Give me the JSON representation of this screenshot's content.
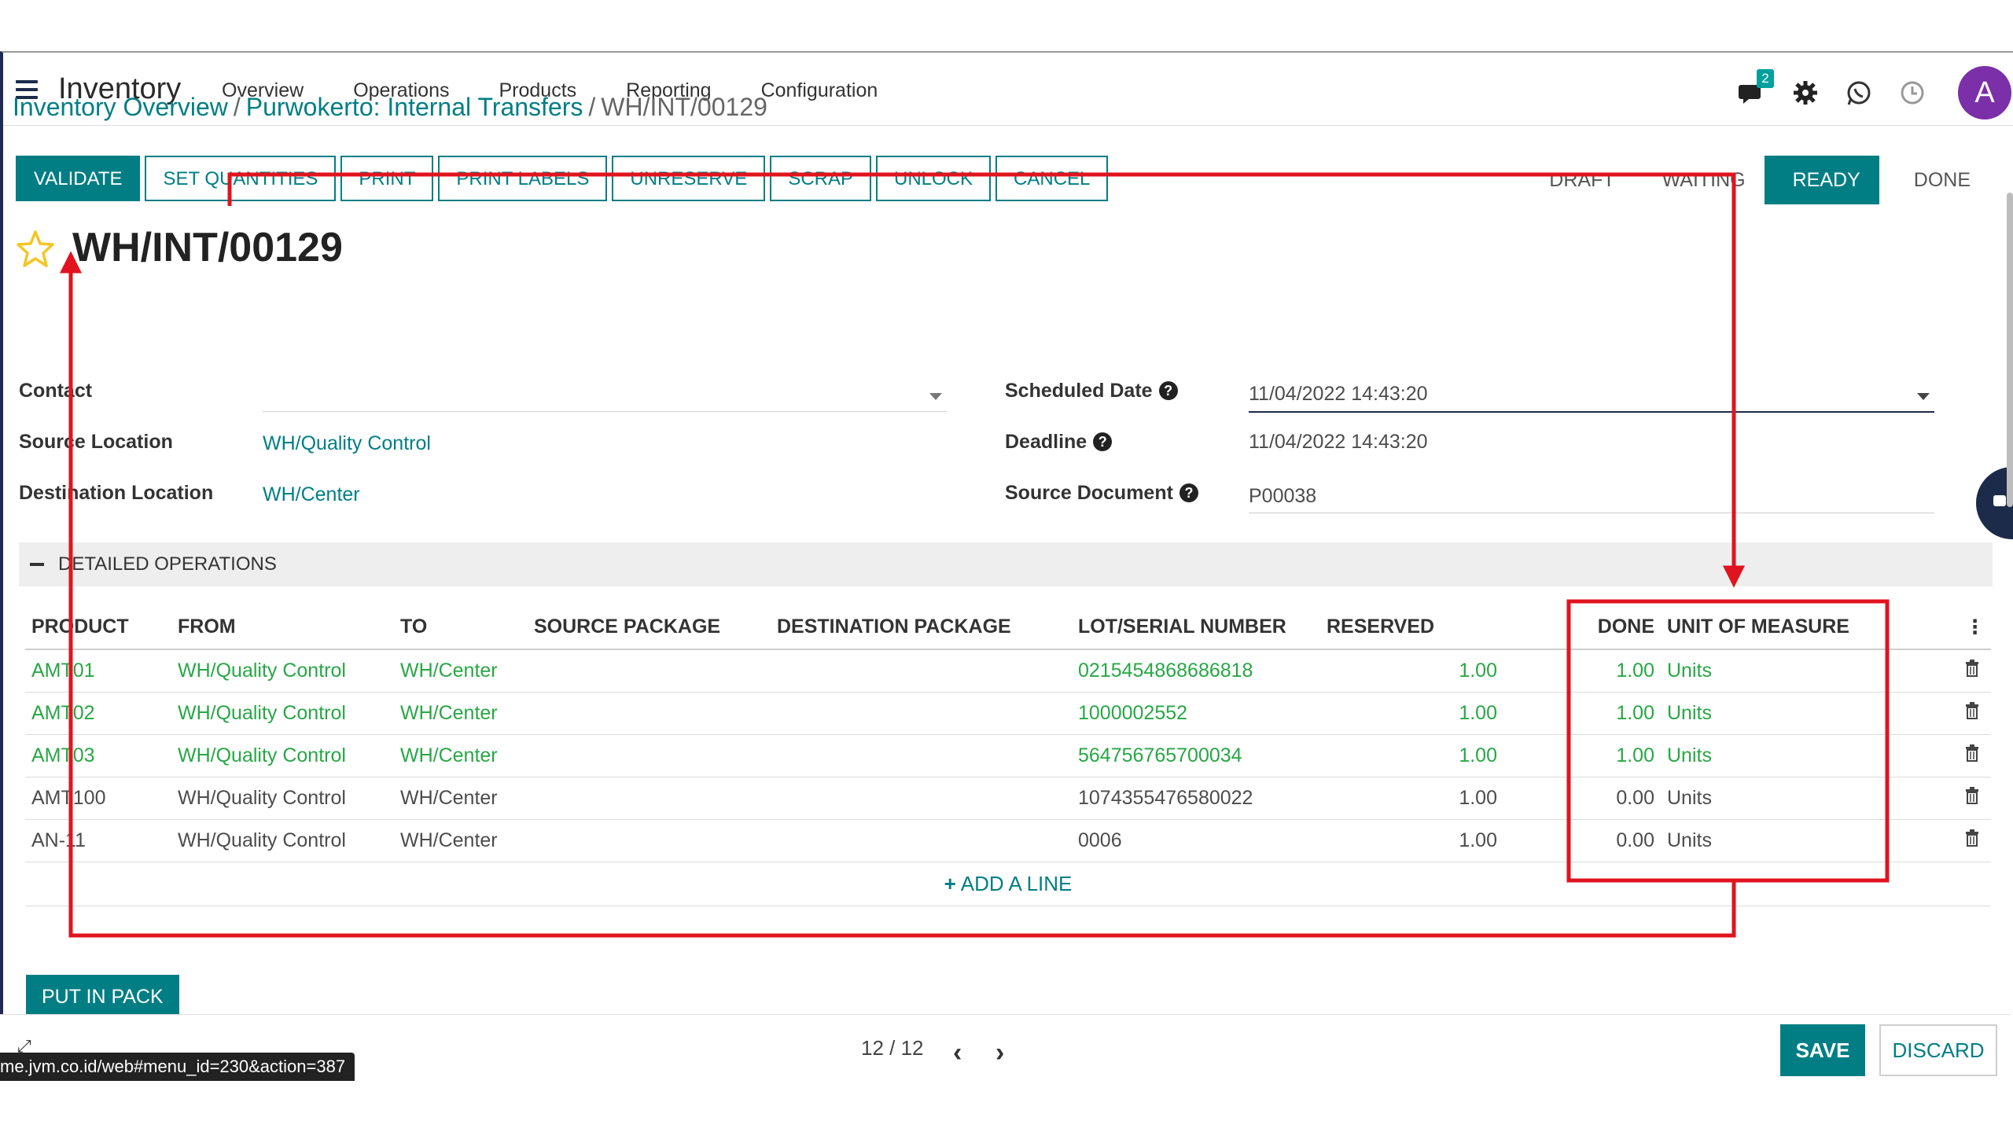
{
  "app": {
    "title": "Inventory",
    "menu": [
      "Overview",
      "Operations",
      "Products",
      "Reporting",
      "Configuration"
    ],
    "messages_badge": "2",
    "avatar_letter": "A",
    "accent_color": "#017e84"
  },
  "breadcrumb": {
    "items": [
      "Inventory Overview",
      "Purwokerto: Internal Transfers"
    ],
    "current": "WH/INT/00129",
    "separator": "/"
  },
  "actions": [
    "VALIDATE",
    "SET QUANTITIES",
    "PRINT",
    "PRINT LABELS",
    "UNRESERVE",
    "SCRAP",
    "UNLOCK",
    "CANCEL"
  ],
  "stages": [
    "DRAFT",
    "WAITING",
    "READY",
    "DONE"
  ],
  "record": {
    "title": "WH/INT/00129",
    "contact_label": "Contact",
    "contact_value": "",
    "source_location_label": "Source Location",
    "source_location": "WH/Quality Control",
    "destination_location_label": "Destination Location",
    "destination_location": "WH/Center",
    "scheduled_date_label": "Scheduled Date",
    "scheduled_date": "11/04/2022 14:43:20",
    "deadline_label": "Deadline",
    "deadline": "11/04/2022 14:43:20",
    "source_document_label": "Source Document",
    "source_document": "P00038"
  },
  "section": {
    "title": "DETAILED OPERATIONS"
  },
  "table": {
    "columns": [
      "PRODUCT",
      "FROM",
      "TO",
      "SOURCE PACKAGE",
      "DESTINATION PACKAGE",
      "LOT/SERIAL NUMBER",
      "RESERVED",
      "DONE",
      "UNIT OF MEASURE"
    ],
    "rows": [
      {
        "product": "AMT01",
        "from": "WH/Quality Control",
        "to": "WH/Center",
        "source_package": "",
        "destination_package": "",
        "lot": "0215454868686818",
        "reserved": "1.00",
        "done": "1.00",
        "uom": "Units"
      },
      {
        "product": "AMT02",
        "from": "WH/Quality Control",
        "to": "WH/Center",
        "source_package": "",
        "destination_package": "",
        "lot": "1000002552",
        "reserved": "1.00",
        "done": "1.00",
        "uom": "Units"
      },
      {
        "product": "AMT03",
        "from": "WH/Quality Control",
        "to": "WH/Center",
        "source_package": "",
        "destination_package": "",
        "lot": "564756765700034",
        "reserved": "1.00",
        "done": "1.00",
        "uom": "Units"
      },
      {
        "product": "AMT100",
        "from": "WH/Quality Control",
        "to": "WH/Center",
        "source_package": "",
        "destination_package": "",
        "lot": "1074355476580022",
        "reserved": "1.00",
        "done": "0.00",
        "uom": "Units"
      },
      {
        "product": "AN-11",
        "from": "WH/Quality Control",
        "to": "WH/Center",
        "source_package": "",
        "destination_package": "",
        "lot": "0006",
        "reserved": "1.00",
        "done": "0.00",
        "uom": "Units"
      }
    ],
    "add_line_label": "ADD A LINE"
  },
  "put_in_pack_label": "PUT IN PACK",
  "footer": {
    "pager": "12 / 12",
    "save_label": "SAVE",
    "discard_label": "DISCARD"
  },
  "status_url": "me.jvm.co.id/web#menu_id=230&action=387"
}
